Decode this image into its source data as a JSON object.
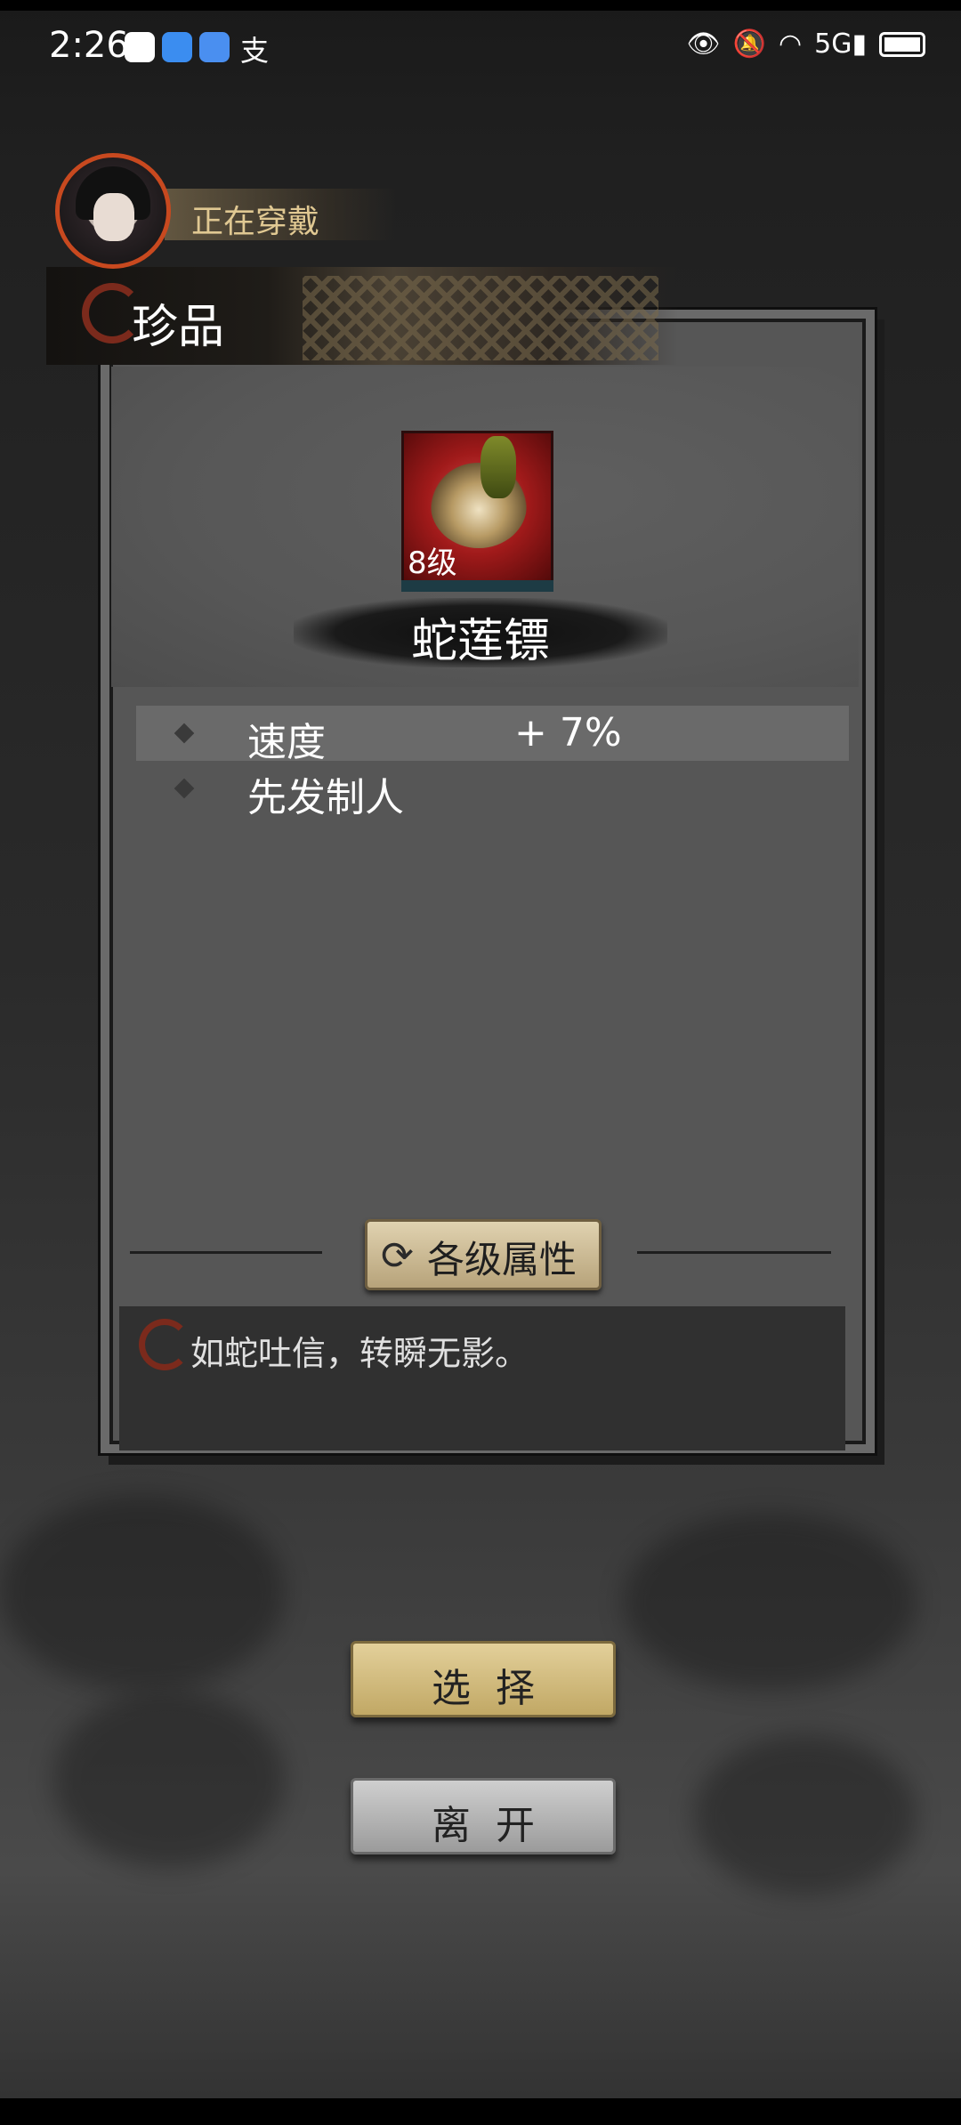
{
  "status_bar": {
    "time": "2:26",
    "left_icons": [
      "message-icon",
      "shield-icon",
      "cloud-icon",
      "alipay-icon"
    ],
    "left_glyphs": [
      "✉",
      "⛊",
      "☁",
      "支"
    ],
    "right_icons": [
      "eye-icon",
      "bell-muted-icon",
      "wifi-icon",
      "signal-5g-icon",
      "battery-icon"
    ],
    "right_glyphs": [
      "👁",
      "🔕",
      "◠",
      "5G▮",
      "▭"
    ]
  },
  "header": {
    "wearing_label": "正在穿戴",
    "rank_label": "珍品"
  },
  "item": {
    "level": "8级",
    "name": "蛇莲镖",
    "attributes": [
      {
        "name": "速度",
        "value": "+ 7%"
      },
      {
        "name": "先发制人",
        "value": ""
      }
    ],
    "level_attributes_button": "各级属性",
    "description": "如蛇吐信，转瞬无影。"
  },
  "actions": {
    "select_label": "选择",
    "leave_label": "离开"
  },
  "colors": {
    "accent_red": "#c8491f",
    "gold_button": "#d7c184",
    "gray_button": "#b8b8b8"
  }
}
